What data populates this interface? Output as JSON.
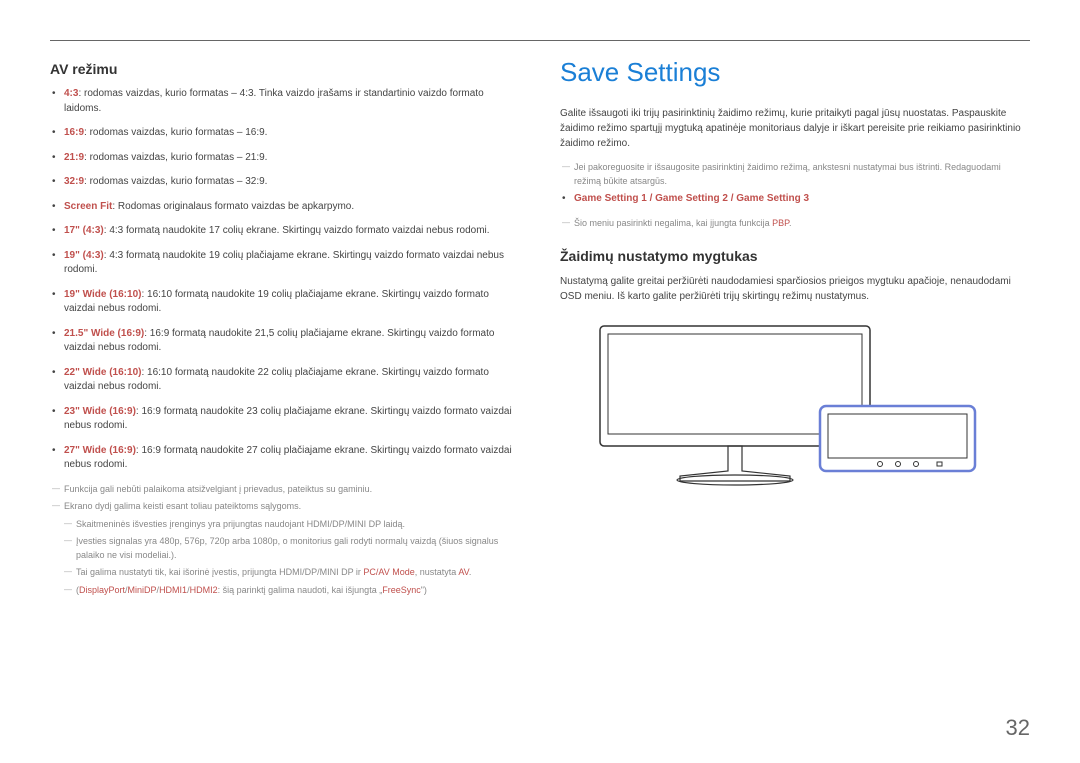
{
  "left": {
    "heading": "AV režimu",
    "items": [
      {
        "label": "4:3",
        "text": ": rodomas vaizdas, kurio formatas – 4:3. Tinka vaizdo įrašams ir standartinio vaizdo formato laidoms."
      },
      {
        "label": "16:9",
        "text": ": rodomas vaizdas, kurio formatas – 16:9."
      },
      {
        "label": "21:9",
        "text": ": rodomas vaizdas, kurio formatas – 21:9."
      },
      {
        "label": "32:9",
        "text": ": rodomas vaizdas, kurio formatas – 32:9."
      },
      {
        "label": "Screen Fit",
        "text": ": Rodomas originalaus formato vaizdas be apkarpymo."
      },
      {
        "label": "17\" (4:3)",
        "text": ": 4:3 formatą naudokite 17 colių ekrane. Skirtingų vaizdo formato vaizdai nebus rodomi."
      },
      {
        "label": "19\" (4:3)",
        "text": ": 4:3 formatą naudokite 19 colių plačiajame ekrane. Skirtingų vaizdo formato vaizdai nebus rodomi."
      },
      {
        "label": "19\" Wide (16:10)",
        "text": ": 16:10 formatą naudokite 19 colių plačiajame ekrane. Skirtingų vaizdo formato vaizdai nebus rodomi."
      },
      {
        "label": "21.5\" Wide (16:9)",
        "text": ": 16:9 formatą naudokite 21,5 colių plačiajame ekrane. Skirtingų vaizdo formato vaizdai nebus rodomi."
      },
      {
        "label": "22\" Wide (16:10)",
        "text": ": 16:10 formatą naudokite 22 colių plačiajame ekrane. Skirtingų vaizdo formato vaizdai nebus rodomi."
      },
      {
        "label": "23\" Wide (16:9)",
        "text": ": 16:9 formatą naudokite 23 colių plačiajame ekrane. Skirtingų vaizdo formato vaizdai nebus rodomi."
      },
      {
        "label": "27\" Wide (16:9)",
        "text": ": 16:9 formatą naudokite 27 colių plačiajame ekrane. Skirtingų vaizdo formato vaizdai nebus rodomi."
      }
    ],
    "notes": {
      "n1": "Funkcija gali nebūti palaikoma atsižvelgiant į prievadus, pateiktus su gaminiu.",
      "n2": "Ekrano dydį galima keisti esant toliau pateiktoms sąlygoms.",
      "n2a": "Skaitmeninės išvesties įrenginys yra prijungtas naudojant HDMI/DP/MINI DP laidą.",
      "n2b": "Įvesties signalas yra 480p, 576p, 720p arba 1080p, o monitorius gali rodyti normalų vaizdą (šiuos signalus palaiko ne visi modeliai.).",
      "n2c_pre": "Tai galima nustatyti tik, kai išorinė įvestis, prijungta HDMI/DP/MINI DP ir ",
      "n2c_pcav": "PC/AV Mode",
      "n2c_mid": ", nustatyta ",
      "n2c_av": "AV",
      "n2c_post": ".",
      "paren_pre": "(",
      "dp": "DisplayPort",
      "slash": "/",
      "minidp": "MiniDP",
      "hdmi1": "HDMI1",
      "hdmi2": "HDMI2",
      "paren_mid": ": šią parinktį galima naudoti, kai išjungta „",
      "freesync": "FreeSync",
      "paren_post": "\")"
    }
  },
  "right": {
    "heading": "Save Settings",
    "para1": "Galite išsaugoti iki trijų pasirinktinių žaidimo režimų, kurie pritaikyti pagal jūsų nuostatas. Paspauskite žaidimo režimo spartųjį mygtuką apatinėje monitoriaus dalyje ir iškart pereisite prie reikiamo pasirinktinio žaidimo režimo.",
    "note1": "Jei pakoreguosite ir išsaugosite pasirinktinį žaidimo režimą, ankstesni nustatymai bus ištrinti. Redaguodami režimą būkite atsargūs.",
    "gs_bullet": "Game Setting 1 / Game Setting 2 / Game Setting 3",
    "note2_pre": "Šio meniu pasirinkti negalima, kai įjungta funkcija ",
    "note2_pbp": "PBP",
    "note2_post": ".",
    "subhead": "Žaidimų nustatymo mygtukas",
    "para2": "Nustatymą galite greitai peržiūrėti naudodamiesi sparčiosios prieigos mygtuku apačioje, nenaudodami OSD meniu. Iš karto galite peržiūrėti trijų skirtingų režimų nustatymus."
  },
  "page_number": "32"
}
